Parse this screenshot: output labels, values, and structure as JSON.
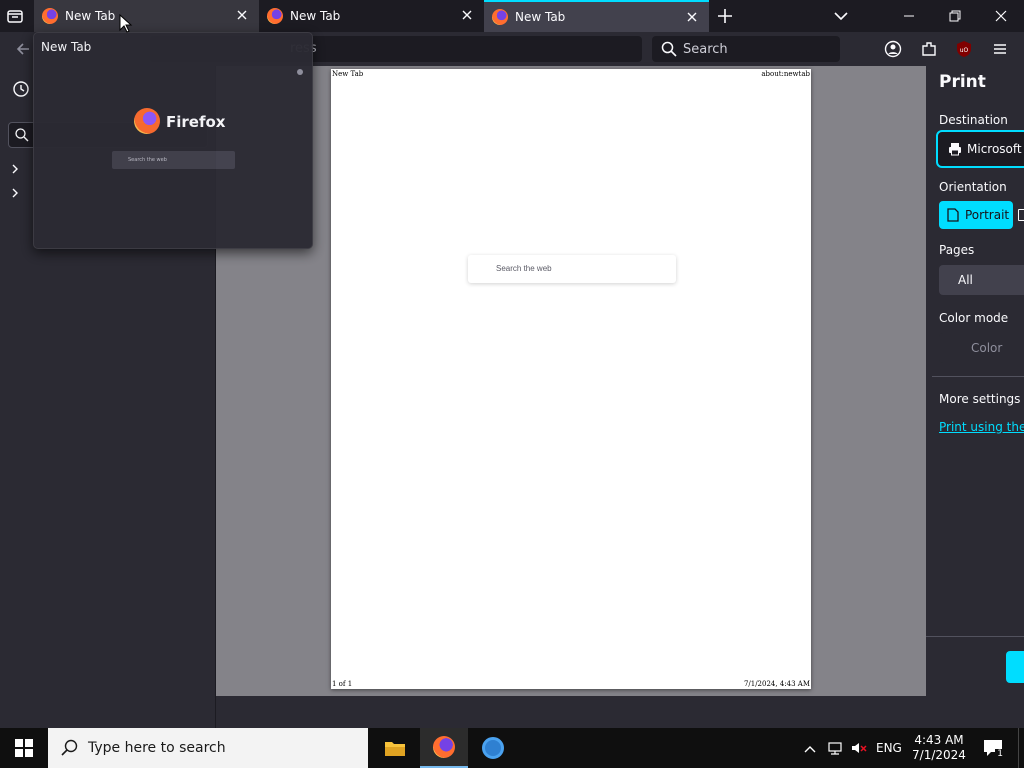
{
  "tabs": [
    {
      "label": "New Tab",
      "state": "hover"
    },
    {
      "label": "New Tab",
      "state": "normal"
    },
    {
      "label": "New Tab",
      "state": "selected"
    }
  ],
  "toolbar": {
    "url_placeholder": "ress",
    "search_placeholder": "Search"
  },
  "tab_preview": {
    "title": "New Tab",
    "brand": "Firefox",
    "search_placeholder": "Search the web"
  },
  "page_preview": {
    "header_left": "New Tab",
    "header_right": "about:newtab",
    "search_placeholder": "Search the web",
    "footer_left": "1 of 1",
    "footer_right": "7/1/2024, 4:43 AM"
  },
  "print_panel": {
    "title": "Print",
    "destination_label": "Destination",
    "destination_value": "Microsoft I",
    "orientation_label": "Orientation",
    "orientation_portrait": "Portrait",
    "pages_label": "Pages",
    "pages_value": "All",
    "color_mode_label": "Color mode",
    "color_mode_value": "Color",
    "more_settings": "More settings",
    "system_dialog_link": "Print using the s"
  },
  "taskbar": {
    "search_placeholder": "Type here to search",
    "language": "ENG",
    "time": "4:43 AM",
    "date": "7/1/2024",
    "notification_count": "1"
  },
  "colors": {
    "accent": "#00ddff",
    "chrome_dark": "#1c1b22",
    "chrome": "#2b2a33",
    "taskbar": "#0f0f0f"
  }
}
